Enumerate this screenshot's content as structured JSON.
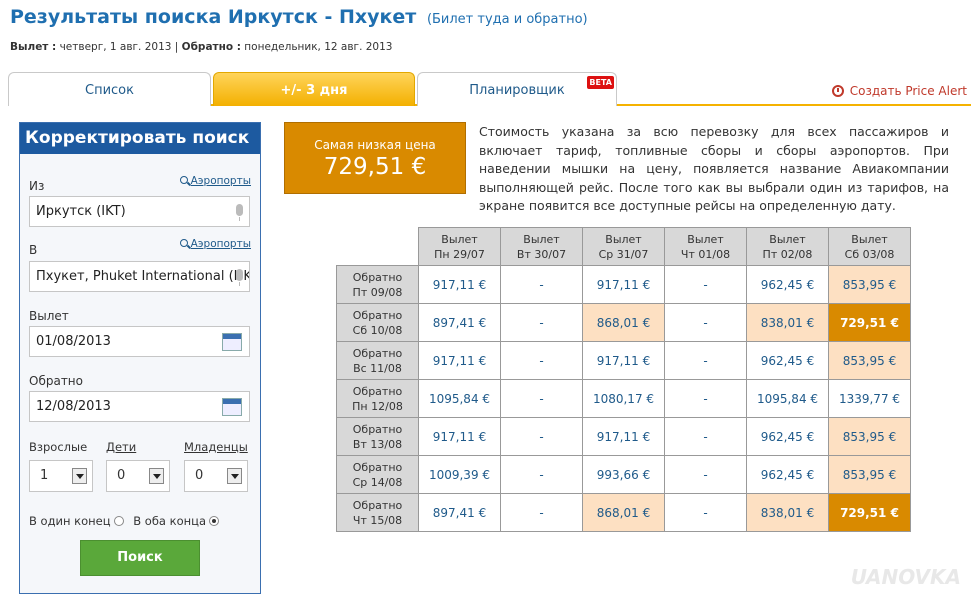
{
  "header": {
    "title": "Результаты поиска Иркутск - Пхукет",
    "subtitle": "(Билет туда и обратно)",
    "dep_label": "Вылет :",
    "dep_value": " четверг, 1 авг. 2013",
    "sep": " | ",
    "ret_label": "Обратно :",
    "ret_value": " понедельник, 12 авг. 2013"
  },
  "tabs": [
    {
      "label": "Список"
    },
    {
      "label": "+/- 3 дня"
    },
    {
      "label": "Планировщик",
      "badge": "BETA"
    }
  ],
  "price_alert": "Создать Price Alert",
  "search_panel": {
    "title": "Корректировать поиск",
    "from_label": "Из",
    "airports_link": "Аэропорты",
    "from_value": "Иркутск (IKT)",
    "to_label": "В",
    "to_value": "Пхукет, Phuket International (HKT)",
    "depart_label": "Вылет",
    "depart_value": "01/08/2013",
    "return_label": "Обратно",
    "return_value": "12/08/2013",
    "adults_label": "Взрослые",
    "children_label": "Дети",
    "infants_label": "Младенцы",
    "adults_value": "1",
    "children_value": "0",
    "infants_value": "0",
    "oneway_label": "В один конец",
    "roundtrip_label": "В оба конца",
    "search_button": "Поиск"
  },
  "lowest": {
    "label": "Самая низкая цена",
    "price": "729,51 €"
  },
  "description": "Стоимость указана за всю перевозку для всех пассажиров и включает тариф, топливные сборы и сборы аэропортов. При наведении мышки на цену, появляется название Авиакомпании выполняющей рейс. После того как вы выбрали один из тарифов, на экране появится все доступные рейсы на определенную дату.",
  "grid": {
    "columns": [
      {
        "l1": "Вылет",
        "l2": "Пн 29/07"
      },
      {
        "l1": "Вылет",
        "l2": "Вт 30/07"
      },
      {
        "l1": "Вылет",
        "l2": "Ср 31/07"
      },
      {
        "l1": "Вылет",
        "l2": "Чт 01/08"
      },
      {
        "l1": "Вылет",
        "l2": "Пт 02/08"
      },
      {
        "l1": "Вылет",
        "l2": "Сб 03/08"
      }
    ],
    "rows": [
      {
        "l1": "Обратно",
        "l2": "Пт 09/08",
        "cells": [
          {
            "v": "917,11 €",
            "s": ""
          },
          {
            "v": "-",
            "s": ""
          },
          {
            "v": "917,11 €",
            "s": ""
          },
          {
            "v": "-",
            "s": ""
          },
          {
            "v": "962,45 €",
            "s": ""
          },
          {
            "v": "853,95 €",
            "s": "peach"
          }
        ]
      },
      {
        "l1": "Обратно",
        "l2": "Сб 10/08",
        "cells": [
          {
            "v": "897,41 €",
            "s": ""
          },
          {
            "v": "-",
            "s": ""
          },
          {
            "v": "868,01 €",
            "s": "peach"
          },
          {
            "v": "-",
            "s": ""
          },
          {
            "v": "838,01 €",
            "s": "peach"
          },
          {
            "v": "729,51 €",
            "s": "best"
          }
        ]
      },
      {
        "l1": "Обратно",
        "l2": "Вс 11/08",
        "cells": [
          {
            "v": "917,11 €",
            "s": ""
          },
          {
            "v": "-",
            "s": ""
          },
          {
            "v": "917,11 €",
            "s": ""
          },
          {
            "v": "-",
            "s": ""
          },
          {
            "v": "962,45 €",
            "s": ""
          },
          {
            "v": "853,95 €",
            "s": "peach"
          }
        ]
      },
      {
        "l1": "Обратно",
        "l2": "Пн 12/08",
        "cells": [
          {
            "v": "1095,84 €",
            "s": ""
          },
          {
            "v": "-",
            "s": ""
          },
          {
            "v": "1080,17 €",
            "s": ""
          },
          {
            "v": "-",
            "s": ""
          },
          {
            "v": "1095,84 €",
            "s": ""
          },
          {
            "v": "1339,77 €",
            "s": ""
          }
        ]
      },
      {
        "l1": "Обратно",
        "l2": "Вт 13/08",
        "cells": [
          {
            "v": "917,11 €",
            "s": ""
          },
          {
            "v": "-",
            "s": ""
          },
          {
            "v": "917,11 €",
            "s": ""
          },
          {
            "v": "-",
            "s": ""
          },
          {
            "v": "962,45 €",
            "s": ""
          },
          {
            "v": "853,95 €",
            "s": "peach"
          }
        ]
      },
      {
        "l1": "Обратно",
        "l2": "Ср 14/08",
        "cells": [
          {
            "v": "1009,39 €",
            "s": ""
          },
          {
            "v": "-",
            "s": ""
          },
          {
            "v": "993,66 €",
            "s": ""
          },
          {
            "v": "-",
            "s": ""
          },
          {
            "v": "962,45 €",
            "s": ""
          },
          {
            "v": "853,95 €",
            "s": "peach"
          }
        ]
      },
      {
        "l1": "Обратно",
        "l2": "Чт 15/08",
        "cells": [
          {
            "v": "897,41 €",
            "s": ""
          },
          {
            "v": "-",
            "s": ""
          },
          {
            "v": "868,01 €",
            "s": "peach"
          },
          {
            "v": "-",
            "s": ""
          },
          {
            "v": "838,01 €",
            "s": "peach"
          },
          {
            "v": "729,51 €",
            "s": "best"
          }
        ]
      }
    ]
  },
  "watermark": "UANOVKA",
  "colors": {
    "brand_blue": "#1f6fb0",
    "orange": "#d98a00",
    "peach": "#fde0c2",
    "green": "#5aa83a"
  }
}
